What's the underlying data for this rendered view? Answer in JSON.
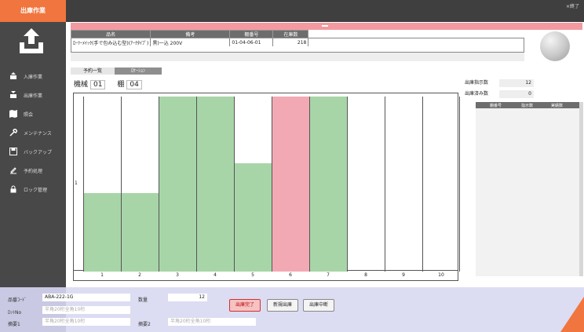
{
  "app": {
    "title": "出庫作業",
    "close_label": "×終了"
  },
  "sidebar": {
    "items": [
      {
        "label": "入庫作業",
        "icon": "box-in-icon"
      },
      {
        "label": "出庫作業",
        "icon": "box-out-icon"
      },
      {
        "label": "照会",
        "icon": "map-icon"
      },
      {
        "label": "メンテナンス",
        "icon": "wrench-icon"
      },
      {
        "label": "バックアップ",
        "icon": "save-icon"
      },
      {
        "label": "予約処理",
        "icon": "edit-icon"
      },
      {
        "label": "ロック管理",
        "icon": "lock-icon"
      }
    ]
  },
  "info": {
    "headers": [
      "品名",
      "備考",
      "棚番号",
      "在庫数"
    ],
    "row": {
      "name": "ﾛｰﾂｰﾒｲｯｸ(手で包み込む型)(ｱｰｸﾀｲﾌﾟ)",
      "note": "黒)一込 200V",
      "shelf": "01-04-06-01",
      "stock": "218"
    }
  },
  "tabs": {
    "schedule": "予約一覧",
    "location": "ﾛｹｰｼｮﾝ"
  },
  "location": {
    "machine_label": "機械",
    "machine_value": "01",
    "shelf_label": "棚",
    "shelf_value": "04"
  },
  "rack": {
    "row_label": "1",
    "columns": [
      {
        "label": "1",
        "fill": 0.45,
        "color": "#a8d5a8"
      },
      {
        "label": "2",
        "fill": 0.45,
        "color": "#a8d5a8"
      },
      {
        "label": "3",
        "fill": 1.0,
        "color": "#a8d5a8"
      },
      {
        "label": "4",
        "fill": 1.0,
        "color": "#a8d5a8"
      },
      {
        "label": "5",
        "fill": 0.62,
        "color": "#a8d5a8"
      },
      {
        "label": "6",
        "fill": 1.0,
        "color": "#f3a9b4"
      },
      {
        "label": "7",
        "fill": 1.0,
        "color": "#a8d5a8"
      },
      {
        "label": "8",
        "fill": 0,
        "color": "#ffffff"
      },
      {
        "label": "9",
        "fill": 0,
        "color": "#ffffff"
      },
      {
        "label": "10",
        "fill": 0,
        "color": "#ffffff"
      }
    ]
  },
  "right_panel": {
    "instruct_label": "出庫指示数",
    "instruct_value": "12",
    "done_label": "出庫済み数",
    "done_value": "0",
    "table_headers": [
      "棚番号",
      "指示数",
      "実績数"
    ]
  },
  "bottom": {
    "product_code_label": "品番ｺｰﾄﾞ",
    "product_code_value": "ABA-222-1G",
    "quantity_label": "数量",
    "quantity_value": "12",
    "lot_label": "ﾛｯﾄNo",
    "lot_placeholder": "半角20桁全角10桁",
    "note1_label": "摘要1",
    "note1_placeholder": "半角20桁全角10桁",
    "note2_label": "摘要2",
    "note2_placeholder": "半角20桁全角10桁",
    "btn_complete": "出庫完了",
    "btn_new": "新規出庫",
    "btn_stop": "出庫中断"
  }
}
